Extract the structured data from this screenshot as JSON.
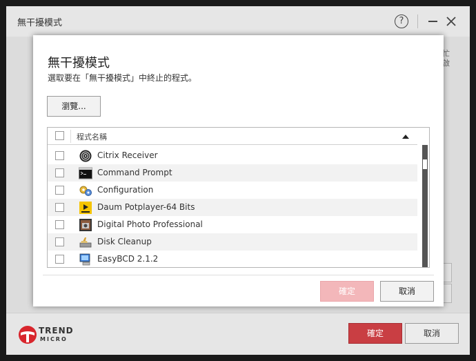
{
  "window": {
    "title": "無干擾模式",
    "help_label": "?",
    "background_side_text": "忙\n啟"
  },
  "footer": {
    "logo_line1": "TREND",
    "logo_line2": "MICRO",
    "ok_label": "確定",
    "cancel_label": "取消"
  },
  "dialog": {
    "title": "無干擾模式",
    "subtitle": "選取要在「無干擾模式」中終止的程式。",
    "browse_label": "瀏覽...",
    "column_header": "程式名稱",
    "items": [
      {
        "label": "Citrix Receiver",
        "icon": "citrix-icon"
      },
      {
        "label": "Command Prompt",
        "icon": "command-prompt-icon"
      },
      {
        "label": "Configuration",
        "icon": "configuration-gears-icon"
      },
      {
        "label": "Daum Potplayer-64 Bits",
        "icon": "potplayer-icon"
      },
      {
        "label": "Digital Photo Professional",
        "icon": "photo-professional-icon"
      },
      {
        "label": "Disk Cleanup",
        "icon": "disk-cleanup-icon"
      },
      {
        "label": "EasyBCD 2.1.2",
        "icon": "easybcd-icon"
      }
    ],
    "ok_label": "確定",
    "cancel_label": "取消"
  },
  "colors": {
    "accent_red": "#c93e43",
    "disabled_red": "#f3b7ba"
  }
}
